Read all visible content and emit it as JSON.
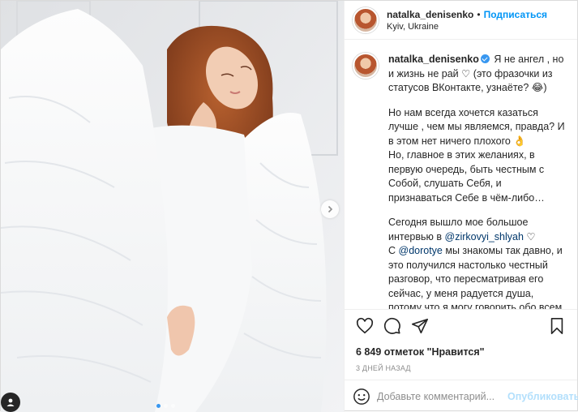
{
  "header": {
    "username": "natalka_denisenko",
    "separator": "•",
    "follow_label": "Подписаться",
    "location": "Kyiv, Ukraine"
  },
  "caption": {
    "username": "natalka_denisenko",
    "p1": "Я не ангел , но и жизнь не рай ♡ (это фразочки из статусов ВКонтакте, узнаёте? 😂)",
    "p2": "Но нам всегда хочется казаться лучше , чем мы являемся, правда? И в этом нет ничего плохого 👌",
    "p3": "Но, главное в этих желаниях, в первую очередь, быть честным с Собой, слушать Себя, и признаваться Себе в чём-либо…",
    "p4_pre": "Сегодня вышло мое большое интервью в ",
    "p4_mention": "@zirkovyi_shlyah",
    "p4_post": " ♡",
    "p5_pre": "С ",
    "p5_mention": "@dorotye",
    "p5_post": " мы знакомы так давно, и это получился настолько честный разговор, что пересматривая его сейчас, у меня радуется душа, потому что я могу говорить обо всем на свете"
  },
  "likes": "6 849 отметок \"Нравится\"",
  "time": "3 ДНЕЙ НАЗАД",
  "comment": {
    "placeholder": "Добавьте комментарий...",
    "publish_label": "Опубликовать"
  },
  "icons": {
    "like": "heart-icon",
    "comment": "comment-icon",
    "share": "paper-plane-icon",
    "save": "bookmark-icon",
    "next": "chevron-right-icon",
    "emoji": "emoji-icon",
    "user_tags": "user-tag-icon"
  },
  "colors": {
    "accent": "#0095f6",
    "publish_disabled": "#b2dffc",
    "muted": "#8e8e8e",
    "verified": "#3897f0"
  },
  "carousel": {
    "total": 3,
    "active": 1
  }
}
